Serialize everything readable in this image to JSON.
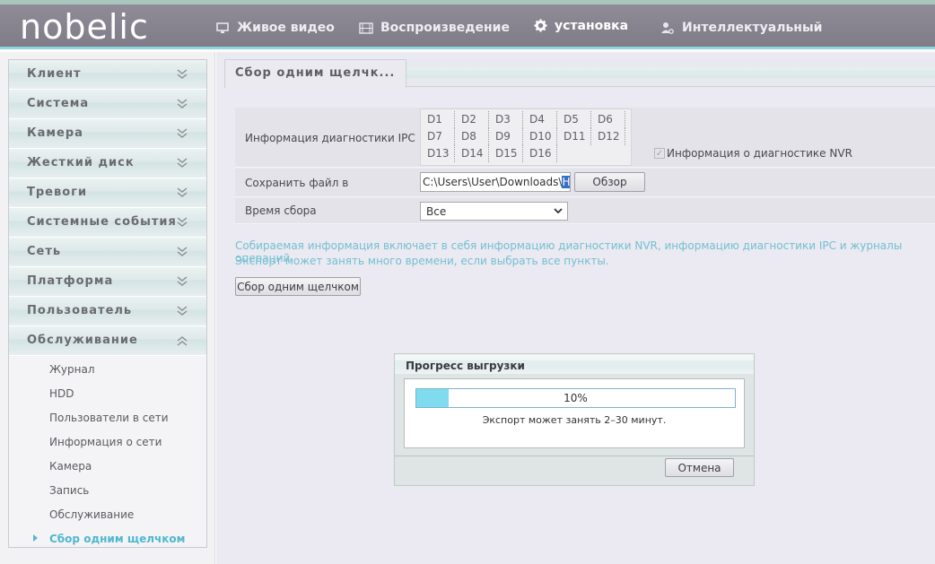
{
  "header": {
    "logo": "nobelic",
    "nav": [
      {
        "label": "Живое видео",
        "icon": "monitor-icon"
      },
      {
        "label": "Воспроизведение",
        "icon": "film-icon"
      },
      {
        "label": "установка",
        "icon": "gear-icon"
      },
      {
        "label": "Интеллектуальный",
        "icon": "user-settings-icon"
      }
    ]
  },
  "sidebar": {
    "sections": [
      {
        "label": "Клиент",
        "expanded": false
      },
      {
        "label": "Система",
        "expanded": false
      },
      {
        "label": "Камера",
        "expanded": false
      },
      {
        "label": "Жесткий диск",
        "expanded": false
      },
      {
        "label": "Тревоги",
        "expanded": false
      },
      {
        "label": "Системные события",
        "expanded": false
      },
      {
        "label": "Сеть",
        "expanded": false
      },
      {
        "label": "Платформа",
        "expanded": false
      },
      {
        "label": "Пользователь",
        "expanded": false
      },
      {
        "label": "Обслуживание",
        "expanded": true
      }
    ],
    "sub_items": [
      {
        "label": "Журнал",
        "selected": false
      },
      {
        "label": "HDD",
        "selected": false
      },
      {
        "label": "Пользователи в сети",
        "selected": false
      },
      {
        "label": "Информация о сети",
        "selected": false
      },
      {
        "label": "Камера",
        "selected": false
      },
      {
        "label": "Запись",
        "selected": false
      },
      {
        "label": "Обслуживание",
        "selected": false
      },
      {
        "label": "Сбор одним щелчком",
        "selected": true
      }
    ]
  },
  "main": {
    "tab_label": "Сбор одним щелчк...",
    "ipc_label": "Информация диагностики IPC",
    "ipc_channels": [
      "D1",
      "D2",
      "D3",
      "D4",
      "D5",
      "D6",
      "D7",
      "D8",
      "D9",
      "D10",
      "D11",
      "D12",
      "D13",
      "D14",
      "D15",
      "D16"
    ],
    "nvr_label": "Информация о диагностике NVR",
    "nvr_checked": true,
    "save_label": "Сохранить файл в",
    "save_path": "C:\\Users\\User\\Downloads\\",
    "save_path_selected": "H",
    "browse_button": "Обзор",
    "time_label": "Время сбора",
    "time_value": "Все",
    "info_line1": "Собираемая информация включает в себя информацию диагностики NVR, информацию диагностики IPC и журналы операций.",
    "info_line2": "Экспорт может занять много времени, если выбрать все пункты.",
    "collect_button": "Сбор одним щелчком"
  },
  "dialog": {
    "title": "Прогресс выгрузки",
    "progress": 10,
    "progress_text": "10%",
    "note": "Экспорт может занять 2–30 минут.",
    "cancel_button": "Отмена"
  },
  "colors": {
    "header_bg": "#8a8794",
    "accent": "#8fd3e0",
    "info_text": "#72c1d2",
    "progress_fill": "#7edcee"
  }
}
